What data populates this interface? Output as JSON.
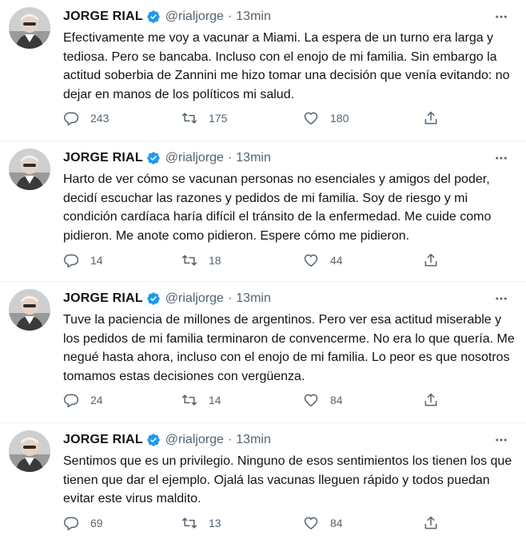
{
  "tweets": [
    {
      "name": "JORGE RIAL",
      "handle": "@rialjorge",
      "separator": "·",
      "time": "13min",
      "text": "Efectivamente me voy a vacunar a Miami. La espera de un turno era larga y tediosa. Pero se bancaba. Incluso con el enojo de mi familia. Sin embargo la actitud soberbia de Zannini me hizo tomar una decisión que venía evitando: no dejar en manos de los políticos mi salud.",
      "replies": "243",
      "retweets": "175",
      "likes": "180"
    },
    {
      "name": "JORGE RIAL",
      "handle": "@rialjorge",
      "separator": "·",
      "time": "13min",
      "text": "Harto de ver cómo se vacunan personas no esenciales y amigos del poder, decidí escuchar las razones y pedidos de mi familia. Soy de riesgo y mi condición cardíaca haría difícil el tránsito de la enfermedad. Me cuide como pidieron. Me anote como pidieron. Espere cómo me pidieron.",
      "replies": "14",
      "retweets": "18",
      "likes": "44"
    },
    {
      "name": "JORGE RIAL",
      "handle": "@rialjorge",
      "separator": "·",
      "time": "13min",
      "text": "Tuve la paciencia de millones de argentinos. Pero ver esa actitud miserable y los pedidos de mi familia terminaron de convencerme. No era lo que quería. Me negué hasta ahora, incluso con el enojo de mi familia. Lo peor es que nosotros tomamos estas decisiones con vergüenza.",
      "replies": "24",
      "retweets": "14",
      "likes": "84"
    },
    {
      "name": "JORGE RIAL",
      "handle": "@rialjorge",
      "separator": "·",
      "time": "13min",
      "text": "Sentimos que es un privilegio. Ninguno de esos sentimientos los tienen los que tienen que dar el ejemplo. Ojalá las vacunas lleguen rápido y todos puedan evitar este virus maldito.",
      "replies": "69",
      "retweets": "13",
      "likes": "84"
    }
  ],
  "colors": {
    "verified_badge": "#1d9bf0",
    "secondary_text": "#536471",
    "primary_text": "#0f1419"
  },
  "icons": [
    "reply-icon",
    "retweet-icon",
    "like-icon",
    "share-icon",
    "more-options-icon",
    "verified-badge-icon"
  ]
}
